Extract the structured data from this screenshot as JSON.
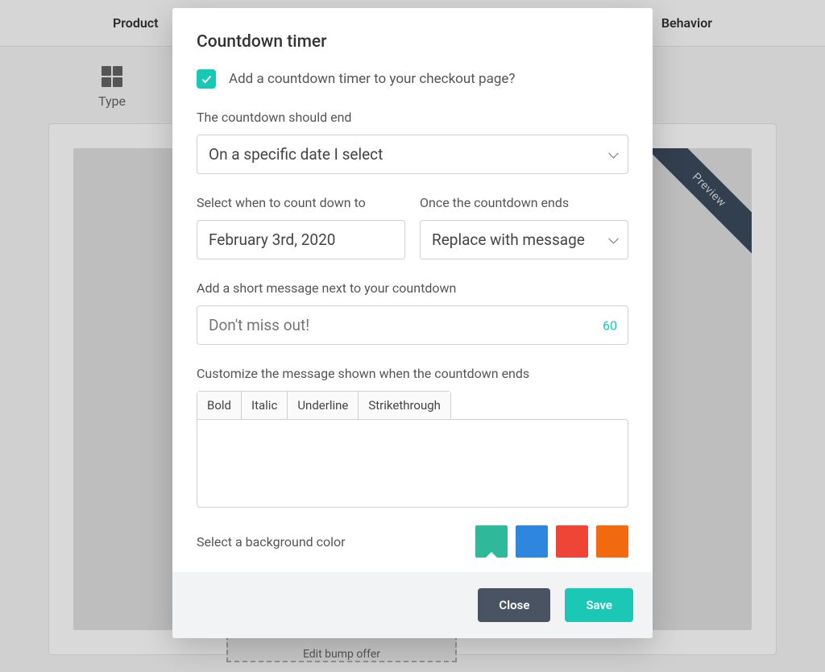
{
  "nav": {
    "left": "Product",
    "right": "Behavior"
  },
  "sidebar": {
    "type_label": "Type"
  },
  "preview": {
    "ribbon": "Preview",
    "bump": "Edit bump offer"
  },
  "modal": {
    "title": "Countdown timer",
    "add_checkbox_label": "Add a countdown timer to your checkout page?",
    "end_label": "The countdown should end",
    "end_select": "On a specific date I select",
    "date_label": "Select when to count down to",
    "date_value": "February 3rd, 2020",
    "after_label": "Once the countdown ends",
    "after_select": "Replace with message",
    "message_label": "Add a short message next to your countdown",
    "message_placeholder": "Don't miss out!",
    "message_counter": "60",
    "customize_label": "Customize the message shown when the countdown ends",
    "toolbar": {
      "bold": "Bold",
      "italic": "Italic",
      "underline": "Underline",
      "strike": "Strikethrough"
    },
    "color_label": "Select a background color",
    "colors": {
      "teal": "#2fb89a",
      "blue": "#2e86de",
      "red": "#ef4536",
      "orange": "#f26a0f"
    },
    "footer": {
      "close": "Close",
      "save": "Save"
    }
  }
}
